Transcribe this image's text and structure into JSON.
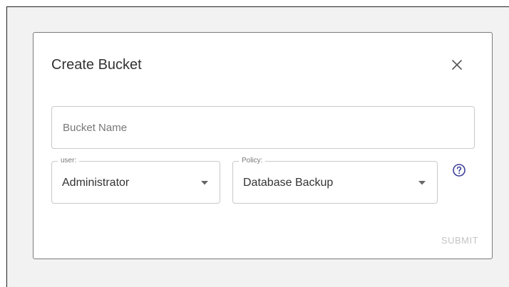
{
  "dialog": {
    "title": "Create Bucket",
    "close_icon": "close-icon"
  },
  "bucket_name": {
    "placeholder": "Bucket Name",
    "value": ""
  },
  "user_select": {
    "label": "user:",
    "value": "Administrator",
    "icon": "dropdown-arrow-icon"
  },
  "policy_select": {
    "label": "Policy:",
    "value": "Database Backup",
    "icon": "dropdown-arrow-icon"
  },
  "help": {
    "icon": "help-circle-icon"
  },
  "actions": {
    "submit_label": "SUBMIT",
    "submit_enabled": false
  },
  "colors": {
    "backdrop": "#f2f2f2",
    "dialog_border": "#7a7a7a",
    "field_border": "#c9c9c9",
    "text": "#333333",
    "muted_text": "#777777",
    "disabled_text": "#c4c4c4",
    "help_icon": "#3c3f99"
  }
}
